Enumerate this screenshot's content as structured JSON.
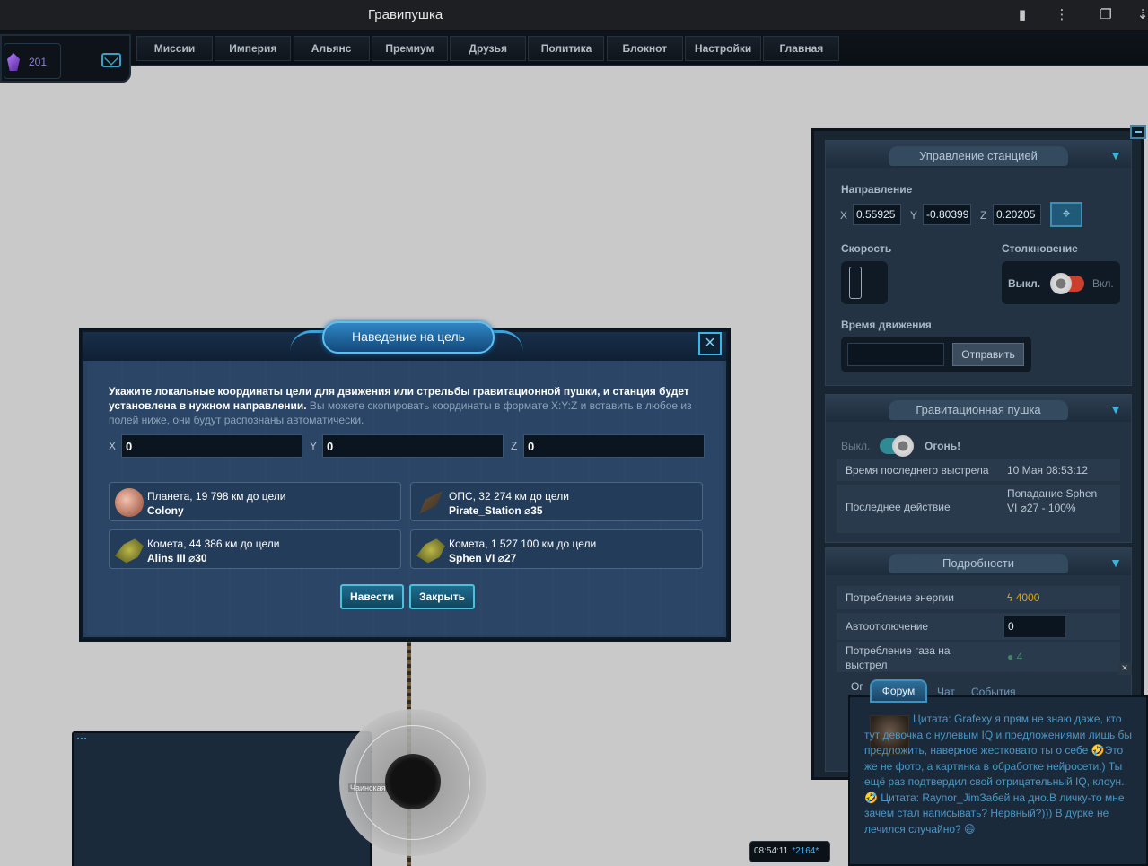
{
  "browser": {
    "title": "Гравипушка"
  },
  "resources": {
    "crystals": "201"
  },
  "nav": {
    "tabs": [
      "Миссии",
      "Империя",
      "Альянс",
      "Премиум",
      "Друзья",
      "Политика",
      "Блокнот",
      "Настройки",
      "Главная"
    ]
  },
  "dialog": {
    "title": "Наведение на цель",
    "instruction_bold": "Укажите локальные координаты цели для движения или стрельбы гравитационной пушки, и станция будет установлена в нужном направлении.",
    "instruction_normal": " Вы можете скопировать координаты в формате X:Y:Z и вставить в любое из полей ниже, они будут распознаны автоматически.",
    "x_label": "X",
    "y_label": "Y",
    "z_label": "Z",
    "x_value": "0",
    "y_value": "0",
    "z_value": "0",
    "targets": [
      {
        "distance": "Планета, 19 798 км до цели",
        "name": "Colony",
        "icon": "planet-icon"
      },
      {
        "distance": "ОПС, 32 274 км до цели",
        "name": "Pirate_Station ⌀35",
        "icon": "station-icon"
      },
      {
        "distance": "Комета, 44 386 км до цели",
        "name": "Alins III ⌀30",
        "icon": "comet-icon"
      },
      {
        "distance": "Комета, 1 527 100 км до цели",
        "name": "Sphen VI ⌀27",
        "icon": "comet-icon"
      }
    ],
    "aim_button": "Навести",
    "close_button": "Закрыть"
  },
  "station": {
    "title": "Управление станцией",
    "direction_label": "Направление",
    "x_label": "X",
    "y_label": "Y",
    "z_label": "Z",
    "x": "0.55925",
    "y": "-0.80399",
    "z": "0.20205",
    "speed_label": "Скорость",
    "collision_label": "Столкновение",
    "collision_off": "Выкл.",
    "collision_on": "Вкл.",
    "move_time_label": "Время движения",
    "send_button": "Отправить"
  },
  "gravity_gun": {
    "title": "Гравитационная пушка",
    "off_label": "Выкл.",
    "fire_label": "Огонь!",
    "last_shot_label": "Время последнего выстрела",
    "last_shot_value": "10 Мая 08:53:12",
    "last_action_label": "Последнее действие",
    "last_action_value": "Попадание Sphen VI ⌀27 - 100%"
  },
  "details": {
    "title": "Подробности",
    "energy_label": "Потребление энергии",
    "energy_value": "4000",
    "auto_off_label": "Автоотключение",
    "auto_off_value": "0",
    "gas_label": "Потребление газа на выстрел",
    "gas_value": "4",
    "partial_label": "Ог"
  },
  "chat": {
    "tabs": [
      "Форум",
      "Чат",
      "События"
    ],
    "message": "Цитата: Grafexy я прям не знаю даже, кто тут девочка с нулевым IQ и предложениями лишь бы предложить, наверное жестковато ты о себе 🤣Это же не фото, а картинка в обработке нейросети.) Ты ещё раз подтвердил свой отрицательный IQ, клоун.🤣 Цитата: Raynor_JimЗабей на дно.В личку-то мне зачем стал написывать? Нервный?))) В дурке не лечился случайно? 😄"
  },
  "clock": {
    "time": "08:54:11",
    "extra": "*2164*"
  },
  "map": {
    "orb_label": "Чаинская"
  },
  "colors": {
    "accent": "#3fb2d8",
    "dialog_bg": "#27415f",
    "energy": "#d8a21b"
  }
}
